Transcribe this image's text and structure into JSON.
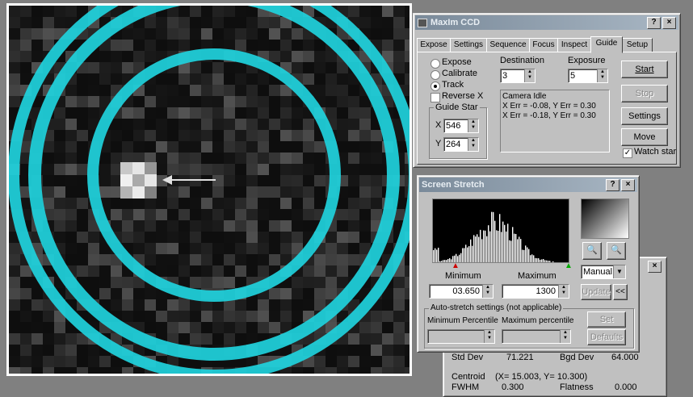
{
  "ccd": {
    "title": "MaxIm CCD",
    "help_btn": "?",
    "close_btn": "×",
    "tabs": [
      "Expose",
      "Settings",
      "Sequence",
      "Focus",
      "Inspect",
      "Guide",
      "Setup"
    ],
    "active_tab": "Guide",
    "mode": [
      "Expose",
      "Calibrate",
      "Track"
    ],
    "mode_selected": "Track",
    "reverse_x": "Reverse X",
    "destination_label": "Destination",
    "destination_value": "3",
    "exposure_label": "Exposure",
    "exposure_value": "5",
    "guide_star_label": "Guide Star",
    "x_label": "X",
    "x_value": "546",
    "y_label": "Y",
    "y_value": "264",
    "status_lines": [
      "Camera Idle",
      "X Err = -0.08, Y Err = 0.30",
      "X Err = -0.18, Y Err = 0.30"
    ],
    "start": "Start",
    "stop": "Stop",
    "settings": "Settings",
    "move": "Move",
    "watch_star": "Watch star"
  },
  "stretch": {
    "title": "Screen Stretch",
    "help_btn": "?",
    "close_btn": "×",
    "minimum_label": "Minimum",
    "maximum_label": "Maximum",
    "min_value": "03.650",
    "max_value": "1300",
    "mode_value": "Manual",
    "update_btn": "Update",
    "expand_btn": "<<",
    "auto_group": "Auto-stretch settings (not applicable)",
    "min_pct": "Minimum Percentile",
    "max_pct": "Maximum percentile",
    "set_btn": "Set",
    "defaults_btn": "Defaults"
  },
  "info": {
    "close_btn": "×",
    "std_dev_label": "Std Dev",
    "std_dev_value": "71.221",
    "bgd_label": "Bgd Dev",
    "bgd_value": "64.000",
    "centroid_label": "Centroid",
    "centroid_value": "(X= 15.003, Y= 10.300)",
    "fwhm_label": "FWHM",
    "fwhm_value": "0.300",
    "flatness_label": "Flatness",
    "flatness_value": "0.000"
  },
  "colors": {
    "ring": "#1fd3dd",
    "titlebar": "#8fa0b0"
  }
}
